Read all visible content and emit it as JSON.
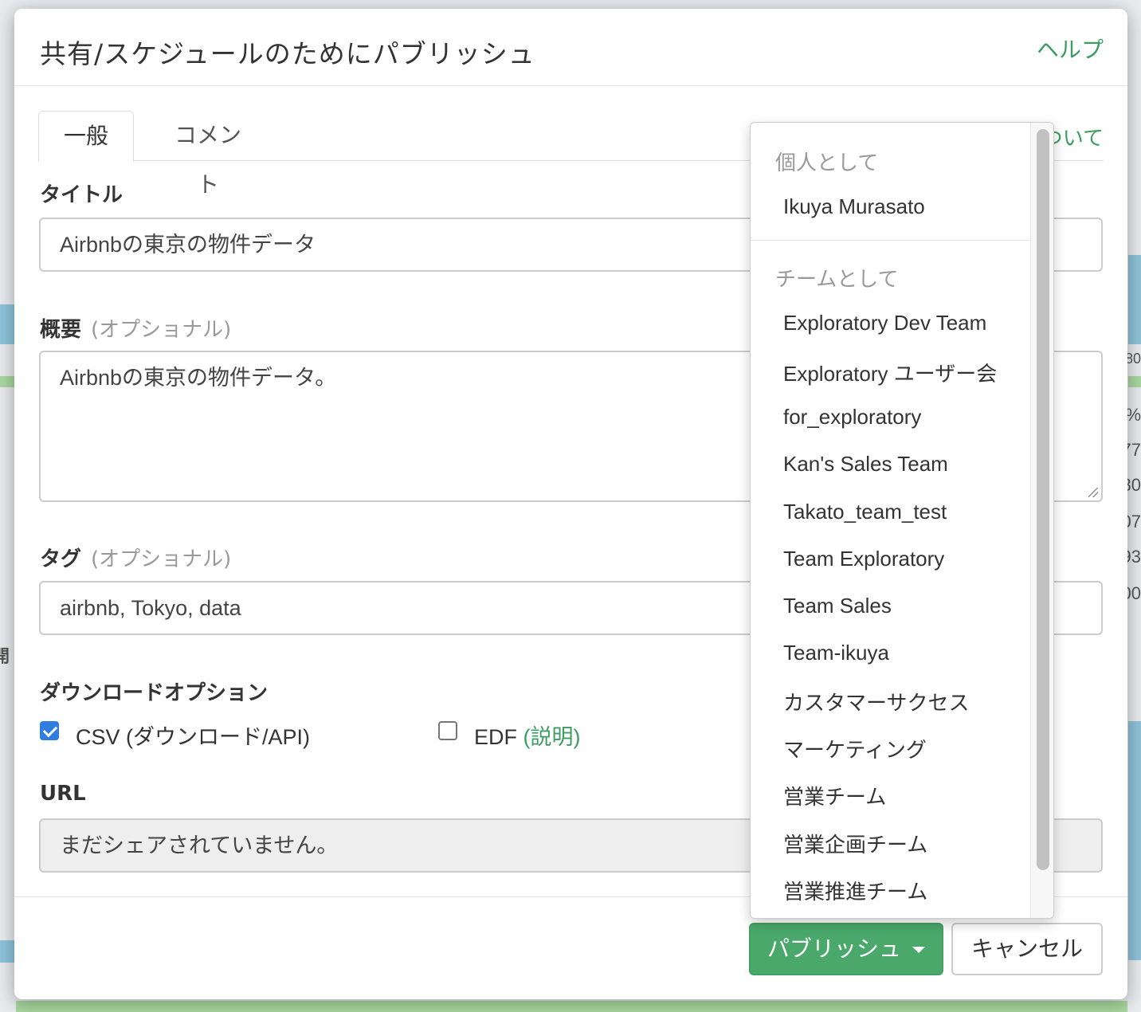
{
  "background": {
    "right_fragments": [
      "80",
      "%",
      "77",
      "80",
      "07",
      "93",
      "00"
    ],
    "left_fragment": "開"
  },
  "dialog": {
    "title": "共有/スケジュールのためにパブリッシュ",
    "help_label": "ヘルプ",
    "tabs": [
      {
        "label": "一般",
        "active": true
      },
      {
        "label": "コメント",
        "active": false
      }
    ],
    "tab_right_partial": "ついて",
    "fields": {
      "title_label": "タイトル",
      "title_value": "Airbnbの東京の物件データ",
      "summary_label": "概要",
      "summary_optional": "(オプショナル)",
      "summary_value": "Airbnbの東京の物件データ。",
      "tags_label": "タグ",
      "tags_optional": "(オプショナル)",
      "tags_value": "airbnb, Tokyo, data",
      "download_label": "ダウンロードオプション",
      "csv_label": "CSV (ダウンロード/API)",
      "csv_checked": true,
      "edf_label": "EDF",
      "edf_link": "(説明)",
      "edf_checked": false,
      "url_label": "URL",
      "url_value": "まだシェアされていません。"
    },
    "footer": {
      "publish_label": "パブリッシュ",
      "cancel_label": "キャンセル"
    }
  },
  "dropdown": {
    "personal_header": "個人として",
    "personal_items": [
      "Ikuya Murasato"
    ],
    "team_header": "チームとして",
    "team_items": [
      "Exploratory Dev Team",
      "Exploratory ユーザー会",
      "for_exploratory",
      "Kan's Sales Team",
      "Takato_team_test",
      "Team Exploratory",
      "Team Sales",
      "Team-ikuya",
      "カスタマーサクセス",
      "マーケティング",
      "営業チーム",
      "営業企画チーム",
      "営業推進チーム"
    ]
  },
  "colors": {
    "accent_green": "#4aa86b",
    "link_green": "#3c9d62",
    "checkbox_blue": "#2f7de1"
  }
}
